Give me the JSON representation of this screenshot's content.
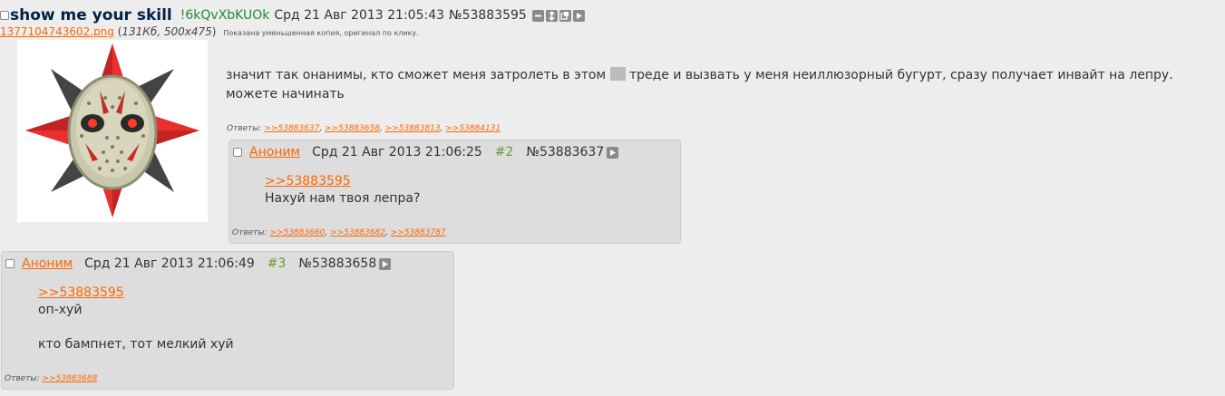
{
  "op": {
    "title": "show me your skill",
    "tripcode": "!6kQvXbKUOk",
    "date": "Срд 21 Авг 2013 21:05:43",
    "number": "№53883595",
    "file": {
      "name": "1377104743602.png",
      "meta_open": " (",
      "meta_size": "131Кб, 500x475",
      "meta_close": ")",
      "note": "Показана уменьшенная копия, оригинал по клику."
    },
    "text_before_spoiler": "значит так онанимы, кто сможет меня затролеть в этом ",
    "text_after_spoiler": " треде и вызвать у меня неиллюзорный бугурт, сразу получает инвайт на лепру.",
    "text_line2": "можете начинать",
    "replies_label": "Ответы: ",
    "replies": [
      ">>53883637",
      ">>53883658",
      ">>53883813",
      ">>53884131"
    ],
    "icons": [
      "hide-icon",
      "expand-icon",
      "favorite-icon",
      "reply-arrow-icon"
    ]
  },
  "posts": [
    {
      "name": "Аноним",
      "date": "Срд 21 Авг 2013 21:06:25",
      "count": "#2",
      "number": "№53883637",
      "link": ">>53883595",
      "line1": "Нахуй нам твоя лепра?",
      "line2": "",
      "replies_label": "Ответы: ",
      "replies": [
        ">>53883660",
        ">>53883682",
        ">>53883787"
      ]
    },
    {
      "name": "Аноним",
      "date": "Срд 21 Авг 2013 21:06:49",
      "count": "#3",
      "number": "№53883658",
      "link": ">>53883595",
      "line1": "оп-хуй",
      "line2": "кто бампнет, тот мелкий хуй",
      "replies_label": "Ответы: ",
      "replies": [
        ">>53883688"
      ]
    }
  ],
  "colors": {
    "background": "#ededed",
    "post_background": "#dddddd",
    "link": "#ff6600",
    "title": "#002244",
    "tripcode": "#228833",
    "post_count": "#669933"
  }
}
